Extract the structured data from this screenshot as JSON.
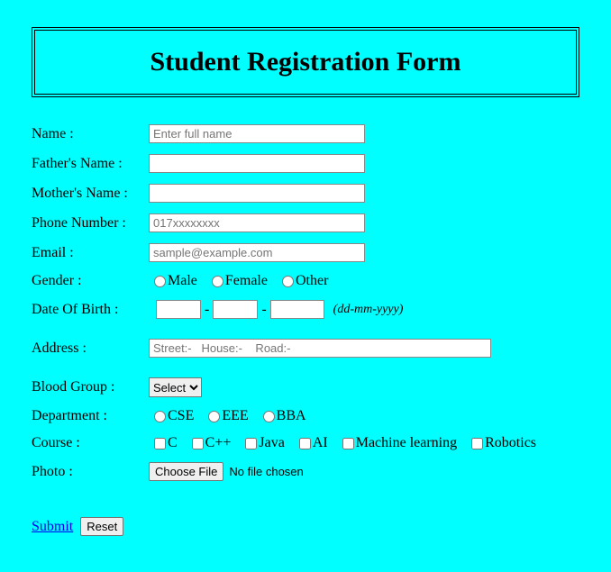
{
  "title": "Student Registration Form",
  "labels": {
    "name": "Name :",
    "father": "Father's Name :",
    "mother": "Mother's Name :",
    "phone": "Phone Number :",
    "email": "Email :",
    "gender": "Gender :",
    "dob": "Date Of Birth :",
    "address": "Address :",
    "blood": "Blood Group :",
    "department": "Department :",
    "course": "Course :",
    "photo": "Photo :"
  },
  "placeholders": {
    "name": "Enter full name",
    "phone": "017xxxxxxxx",
    "email": "sample@example.com",
    "address": "Street:-   House:-    Road:-"
  },
  "dob": {
    "sep": "-",
    "hint": "(dd-mm-yyyy)"
  },
  "gender_options": {
    "o0": "Male",
    "o1": "Female",
    "o2": "Other"
  },
  "blood_selected": "Select",
  "department_options": {
    "o0": "CSE",
    "o1": "EEE",
    "o2": "BBA"
  },
  "course_options": {
    "o0": "C",
    "o1": "C++",
    "o2": "Java",
    "o3": "AI",
    "o4": "Machine learning",
    "o5": "Robotics"
  },
  "file": {
    "button": "Choose File",
    "status": "No file chosen"
  },
  "actions": {
    "submit": "Submit",
    "reset": "Reset"
  }
}
